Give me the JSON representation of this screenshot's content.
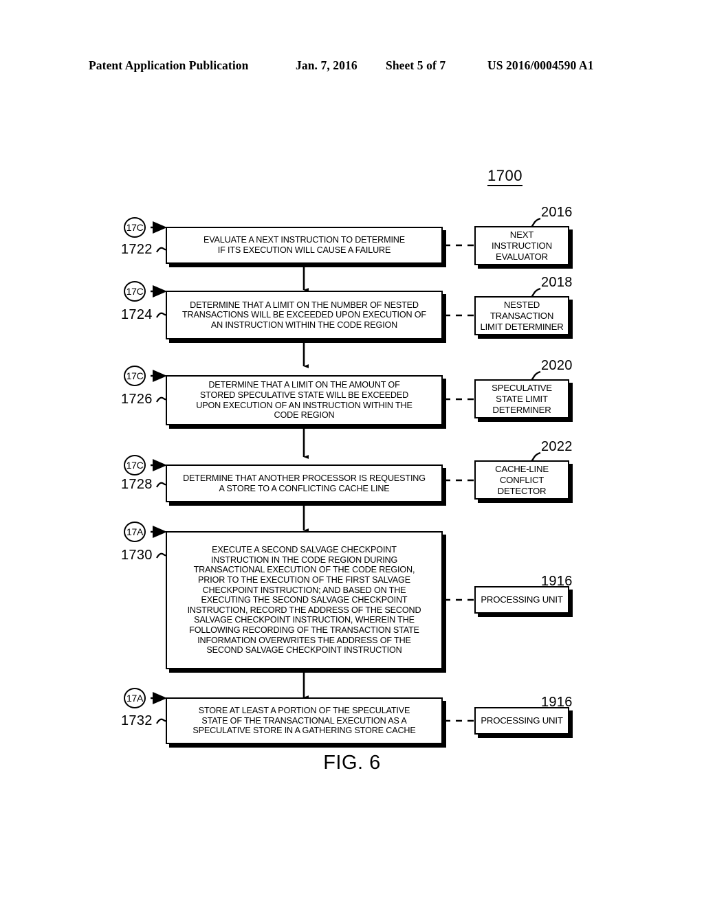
{
  "header": {
    "left": "Patent Application Publication",
    "date": "Jan. 7, 2016",
    "sheet": "Sheet 5 of 7",
    "number": "US 2016/0004590 A1"
  },
  "figure": {
    "flow_ref": "1700",
    "caption": "FIG. 6"
  },
  "steps": [
    {
      "ref": "1722",
      "connector": "17C",
      "text": "EVALUATE A NEXT INSTRUCTION TO DETERMINE\nIF ITS EXECUTION WILL CAUSE A FAILURE"
    },
    {
      "ref": "1724",
      "connector": "17C",
      "text": "DETERMINE THAT A LIMIT ON THE NUMBER OF NESTED\nTRANSACTIONS WILL BE EXCEEDED UPON EXECUTION OF\nAN INSTRUCTION WITHIN THE CODE REGION"
    },
    {
      "ref": "1726",
      "connector": "17C",
      "text": "DETERMINE THAT A LIMIT ON THE AMOUNT OF\nSTORED SPECULATIVE STATE WILL BE EXCEEDED\nUPON EXECUTION OF AN INSTRUCTION WITHIN THE\nCODE REGION"
    },
    {
      "ref": "1728",
      "connector": "17C",
      "text": "DETERMINE THAT ANOTHER PROCESSOR IS REQUESTING\nA STORE TO A CONFLICTING CACHE LINE"
    },
    {
      "ref": "1730",
      "connector": "17A",
      "text": "EXECUTE A SECOND SALVAGE CHECKPOINT\nINSTRUCTION IN THE CODE REGION DURING\nTRANSACTIONAL EXECUTION OF THE CODE REGION,\nPRIOR TO THE EXECUTION OF THE FIRST SALVAGE\nCHECKPOINT INSTRUCTION; AND BASED ON THE\nEXECUTING THE SECOND SALVAGE CHECKPOINT\nINSTRUCTION, RECORD THE ADDRESS OF THE SECOND\nSALVAGE CHECKPOINT INSTRUCTION, WHEREIN THE\nFOLLOWING RECORDING OF THE TRANSACTION STATE\nINFORMATION OVERWRITES THE ADDRESS OF THE\nSECOND SALVAGE CHECKPOINT INSTRUCTION"
    },
    {
      "ref": "1732",
      "connector": "17A",
      "text": "STORE AT LEAST A PORTION OF THE SPECULATIVE\nSTATE OF THE TRANSACTIONAL EXECUTION AS A\nSPECULATIVE STORE IN A GATHERING STORE CACHE"
    }
  ],
  "components": [
    {
      "ref": "2016",
      "text": "NEXT\nINSTRUCTION\nEVALUATOR"
    },
    {
      "ref": "2018",
      "text": "NESTED\nTRANSACTION\nLIMIT DETERMINER"
    },
    {
      "ref": "2020",
      "text": "SPECULATIVE\nSTATE LIMIT\nDETERMINER"
    },
    {
      "ref": "2022",
      "text": "CACHE-LINE\nCONFLICT\nDETECTOR"
    },
    {
      "ref": "1916",
      "text": "PROCESSING UNIT"
    },
    {
      "ref": "1916",
      "text": "PROCESSING UNIT"
    }
  ],
  "colors": {
    "ink": "#000000",
    "paper": "#ffffff"
  }
}
